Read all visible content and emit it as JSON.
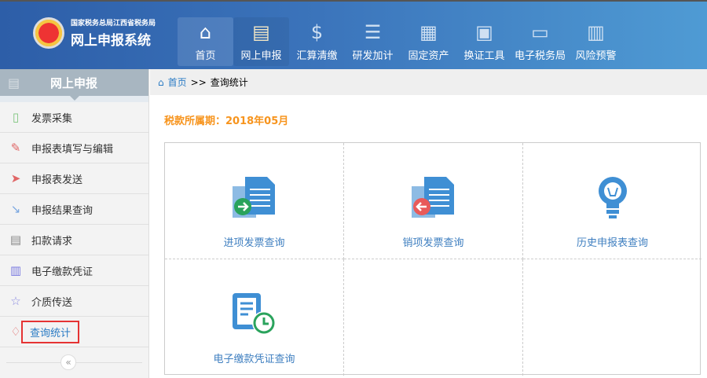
{
  "header": {
    "org": "国家税务总局江西省税务局",
    "system": "网上申报系统",
    "nav": [
      {
        "label": "首页",
        "icon": "home-icon"
      },
      {
        "label": "网上申报",
        "icon": "declare-icon"
      },
      {
        "label": "汇算清缴",
        "icon": "dollar-icon"
      },
      {
        "label": "研发加计",
        "icon": "coins-icon"
      },
      {
        "label": "固定资产",
        "icon": "asset-icon"
      },
      {
        "label": "换证工具",
        "icon": "certificate-icon"
      },
      {
        "label": "电子税务局",
        "icon": "monitor-icon"
      },
      {
        "label": "风险预警",
        "icon": "clipboard-icon"
      }
    ]
  },
  "sidebar": {
    "title": "网上申报",
    "items": [
      {
        "label": "发票采集",
        "icon": "invoice-icon"
      },
      {
        "label": "申报表填写与编辑",
        "icon": "edit-icon"
      },
      {
        "label": "申报表发送",
        "icon": "send-icon"
      },
      {
        "label": "申报结果查询",
        "icon": "result-icon"
      },
      {
        "label": "扣款请求",
        "icon": "deduct-icon"
      },
      {
        "label": "电子缴款凭证",
        "icon": "voucher-icon"
      },
      {
        "label": "介质传送",
        "icon": "star-icon"
      },
      {
        "label": "查询统计",
        "icon": "rocket-icon"
      }
    ],
    "collapse": "«"
  },
  "breadcrumb": {
    "home": "首页",
    "sep": ">>",
    "current": "查询统计"
  },
  "period": "税款所属期：2018年05月",
  "tiles": [
    {
      "label": "进项发票查询"
    },
    {
      "label": "销项发票查询"
    },
    {
      "label": "历史申报表查询"
    },
    {
      "label": "电子缴款凭证查询"
    }
  ],
  "colors": {
    "accent": "#2a7bc4",
    "period": "#f7941d"
  }
}
